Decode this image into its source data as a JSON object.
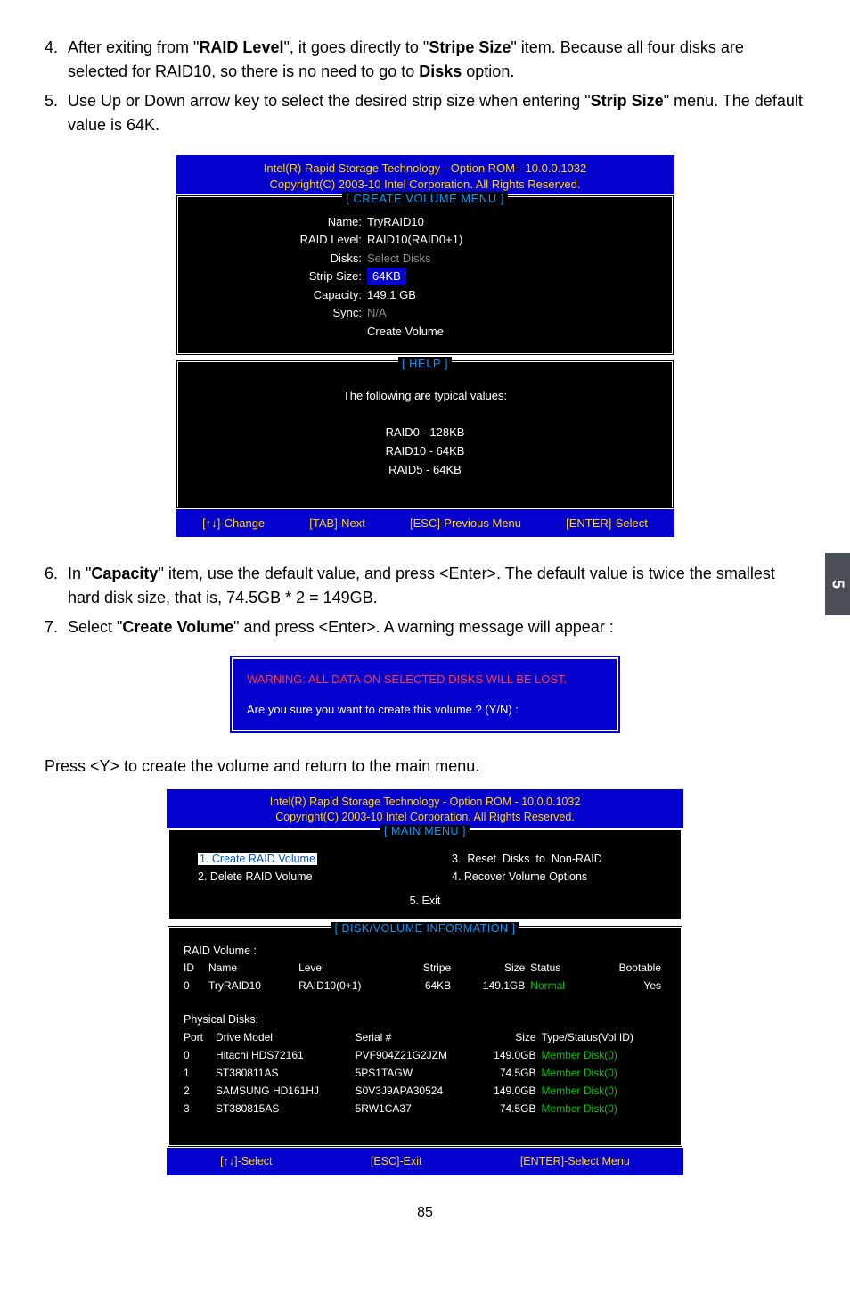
{
  "page_tab": "5",
  "page_number": "85",
  "instructions": {
    "step4_num": "4.",
    "step4_text_a": "After exiting from \"",
    "step4_b1": "RAID Level",
    "step4_text_b": "\", it goes directly to \"",
    "step4_b2": "Stripe Size",
    "step4_text_c": "\" item. Because all four disks are selected for RAID10, so there is no need to go to ",
    "step4_b3": "Disks",
    "step4_text_d": " option.",
    "step5_num": "5.",
    "step5_text_a": "Use Up or Down arrow key to select the desired strip size when entering \"",
    "step5_b1": "Strip Size",
    "step5_text_b": "\" menu. The default value is 64K.",
    "step6_num": "6.",
    "step6_text_a": "In \"",
    "step6_b1": "Capacity",
    "step6_text_b": "\" item, use the default value, and press <Enter>. The default value is twice the smallest hard disk size, that is, 74.5GB * 2 = 149GB.",
    "step7_num": "7.",
    "step7_text_a": "Select \"",
    "step7_b1": "Create Volume",
    "step7_text_b": "\" and press <Enter>. A warning message will appear :",
    "press_line": "Press <Y> to create the volume and return to the main menu."
  },
  "bios1": {
    "hdr1": "Intel(R) Rapid Storage Technology - Option ROM - 10.0.0.1032",
    "hdr2": "Copyright(C) 2003-10 Intel Corporation.   All Rights Reserved.",
    "title_create": "[ CREATE VOLUME MENU ]",
    "form": {
      "name_l": "Name:",
      "name_v": "TryRAID10",
      "level_l": "RAID Level:",
      "level_v": "RAID10(RAID0+1)",
      "disks_l": "Disks:",
      "disks_v": "Select Disks",
      "strip_l": "Strip Size:",
      "strip_v": "64KB",
      "cap_l": "Capacity:",
      "cap_v": "149.1   GB",
      "sync_l": "Sync:",
      "sync_v": "N/A",
      "create_v": "Create Volume"
    },
    "title_help": "[ HELP ]",
    "help": {
      "intro": "The following are typical values:",
      "l1": "RAID0   -  128KB",
      "l2": "RAID10 -  64KB",
      "l3": "RAID5  -  64KB"
    },
    "footer": {
      "f1": "[↑↓]-Change",
      "f2": "[TAB]-Next",
      "f3": "[ESC]-Previous Menu",
      "f4": "[ENTER]-Select"
    }
  },
  "warning": {
    "l1": "WARNING: ALL DATA ON SELECTED DISKS WILL BE LOST.",
    "l2": "Are you sure you want to create this volume ? (Y/N) :"
  },
  "bios2": {
    "hdr1": "Intel(R) Rapid Storage Technology - Option ROM - 10.0.0.1032",
    "hdr2": "Copyright(C) 2003-10 Intel Corporation.   All Rights Reserved.",
    "title_main": "[ MAIN MENU ]",
    "menu": {
      "m1": "1. Create RAID Volume",
      "m2": "2. Delete RAID Volume",
      "m3": "3.  Reset  Disks  to  Non-RAID",
      "m4": "4. Recover Volume Options",
      "m5": "5. Exit"
    },
    "title_info": "[ DISK/VOLUME INFORMATION ]",
    "raid_header": "RAID Volume :",
    "raid_cols": {
      "c1": "ID",
      "c2": "Name",
      "c3": "Level",
      "c4": "Stripe",
      "c5": "Size",
      "c6": "Status",
      "c7": "Bootable"
    },
    "raid_row": {
      "c1": "0",
      "c2": "TryRAID10",
      "c3": "RAID10(0+1)",
      "c4": "64KB",
      "c5": "149.1GB",
      "c6": "Normal",
      "c7": "Yes"
    },
    "phys_header": "Physical Disks:",
    "phys_cols": {
      "c1": "Port",
      "c2": "Drive Model",
      "c3": "Serial #",
      "c4": "Size",
      "c5": "Type/Status(Vol ID)"
    },
    "phys_rows": [
      {
        "c1": "0",
        "c2": "Hitachi HDS72161",
        "c3": "PVF904Z21G2JZM",
        "c4": "149.0GB",
        "c5": "Member Disk(0)"
      },
      {
        "c1": "1",
        "c2": "ST380811AS",
        "c3": "5PS1TAGW",
        "c4": "74.5GB",
        "c5": "Member Disk(0)"
      },
      {
        "c1": "2",
        "c2": "SAMSUNG HD161HJ",
        "c3": "S0V3J9APA30524",
        "c4": "149.0GB",
        "c5": "Member Disk(0)"
      },
      {
        "c1": "3",
        "c2": "ST380815AS",
        "c3": "5RW1CA37",
        "c4": "74.5GB",
        "c5": "Member Disk(0)"
      }
    ],
    "footer": {
      "f1": "[↑↓]-Select",
      "f2": "[ESC]-Exit",
      "f3": "[ENTER]-Select Menu"
    }
  }
}
